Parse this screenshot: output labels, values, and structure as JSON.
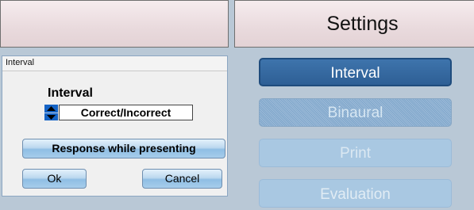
{
  "header": {
    "title": "Settings"
  },
  "dialog": {
    "title": "Interval",
    "field_label": "Interval",
    "field_value": "Correct/Incorrect",
    "response_button": "Response while presenting",
    "ok_button": "Ok",
    "cancel_button": "Cancel"
  },
  "nav": {
    "interval": "Interval",
    "binaural": "Binaural",
    "print": "Print",
    "evaluation": "Evaluation"
  },
  "colors": {
    "accent": "#2e5f95",
    "spinner": "#1563c5"
  }
}
